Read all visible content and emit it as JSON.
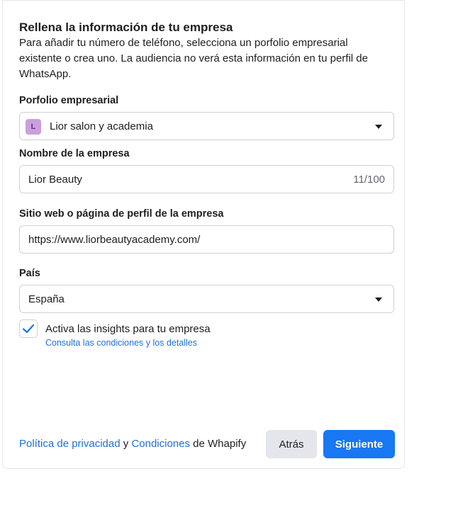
{
  "header": {
    "title": "Rellena la información de tu empresa",
    "description": "Para añadir tu número de teléfono, selecciona un porfolio empresarial existente o crea uno. La audiencia no verá esta información en tu perfil de WhatsApp."
  },
  "portfolio": {
    "label": "Porfolio empresarial",
    "avatar_letter": "L",
    "value": "Lior salon y academia",
    "icon": "chevron-down-icon"
  },
  "company_name": {
    "label": "Nombre de la empresa",
    "value": "Lior Beauty",
    "counter": "11/100"
  },
  "website": {
    "label": "Sitio web o página de perfil de la empresa",
    "value": "https://www.liorbeautyacademy.com/"
  },
  "country": {
    "label": "País",
    "value": "España",
    "icon": "chevron-down-icon"
  },
  "insights": {
    "checked": true,
    "label": "Activa las insights para tu empresa",
    "link": "Consulta las condiciones y los detalles",
    "icon": "check-icon"
  },
  "footer": {
    "privacy_link": "Política de privacidad",
    "and_text": "y",
    "terms_link": "Condiciones",
    "suffix": "de Whapify",
    "back_label": "Atrás",
    "next_label": "Siguiente"
  },
  "colors": {
    "primary": "#1877f2",
    "link": "#216fdb",
    "avatar_bg": "#c9a0dc"
  }
}
